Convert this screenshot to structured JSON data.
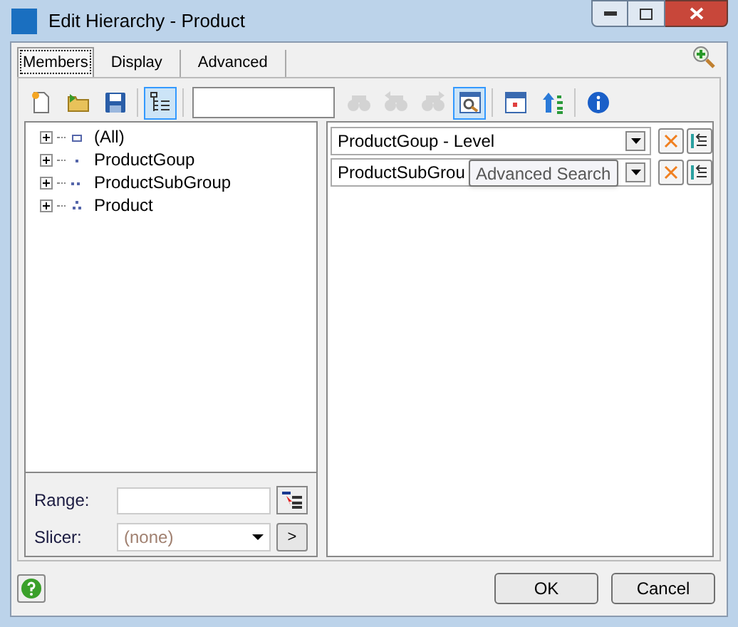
{
  "window": {
    "title": "Edit Hierarchy - Product"
  },
  "tabs": [
    {
      "label": "Members",
      "selected": true
    },
    {
      "label": "Display",
      "selected": false
    },
    {
      "label": "Advanced",
      "selected": false
    }
  ],
  "toolbar": [
    {
      "kind": "new",
      "selected": false,
      "disabled": false
    },
    {
      "kind": "open",
      "selected": false,
      "disabled": false
    },
    {
      "kind": "save",
      "selected": false,
      "disabled": false
    },
    {
      "kind": "tree",
      "selected": true,
      "disabled": false
    },
    {
      "kind": "field"
    },
    {
      "kind": "find",
      "selected": false,
      "disabled": true
    },
    {
      "kind": "find-prev",
      "selected": false,
      "disabled": true
    },
    {
      "kind": "find-next",
      "selected": false,
      "disabled": true
    },
    {
      "kind": "search",
      "selected": true,
      "disabled": false
    },
    {
      "kind": "calendar",
      "selected": false,
      "disabled": false
    },
    {
      "kind": "sort",
      "selected": false,
      "disabled": false
    },
    {
      "kind": "info",
      "selected": false,
      "disabled": false
    }
  ],
  "tree": [
    {
      "label": "(All)",
      "expanded": false
    },
    {
      "label": "ProductGoup",
      "expanded": false
    },
    {
      "label": "ProductSubGroup",
      "expanded": false
    },
    {
      "label": "Product",
      "expanded": false
    }
  ],
  "range": {
    "label": "Range:"
  },
  "slicer": {
    "label": "Slicer:",
    "value": "(none)",
    "button": ">"
  },
  "levels": [
    {
      "value": "ProductGoup - Level"
    },
    {
      "value": "ProductSubGrou"
    }
  ],
  "tooltip": "Advanced Search",
  "buttons": [
    "OK",
    "Cancel"
  ]
}
